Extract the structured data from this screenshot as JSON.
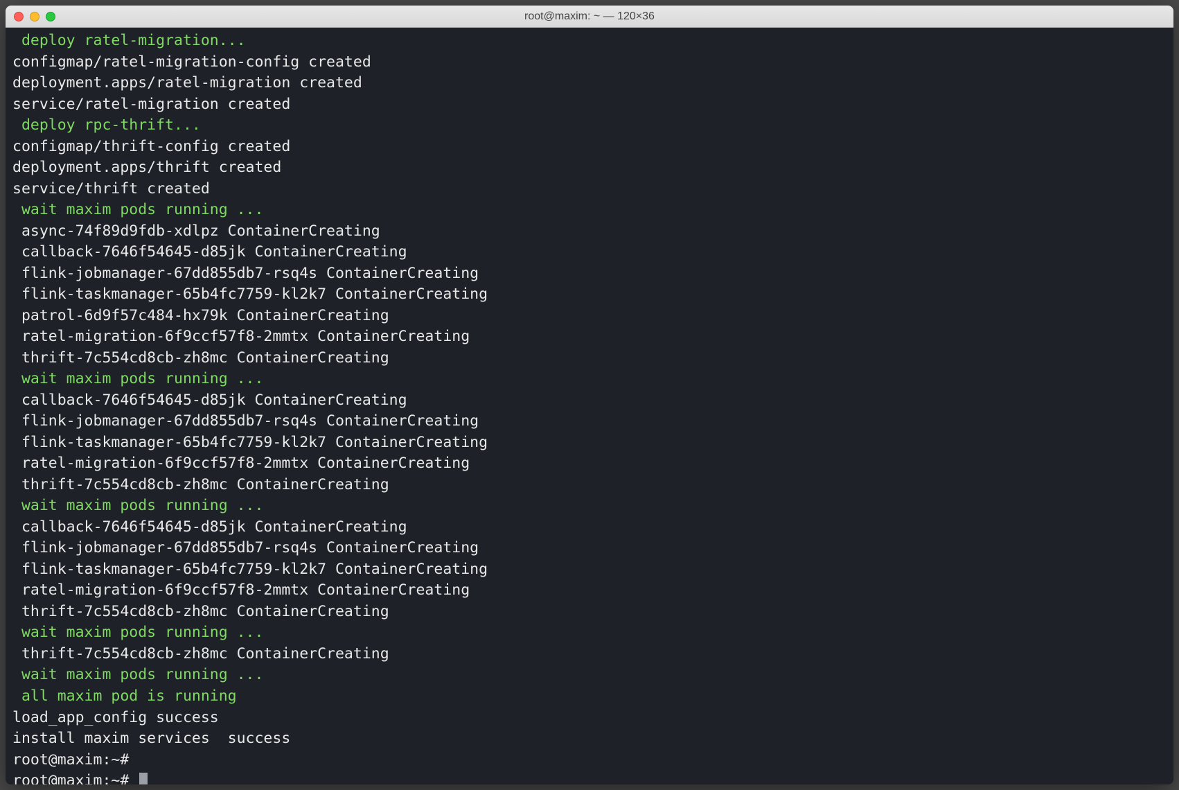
{
  "window": {
    "title": "root@maxim: ~ — 120×36"
  },
  "lines": [
    {
      "indent": " ",
      "text": "deploy ratel-migration...",
      "color": "green"
    },
    {
      "indent": "",
      "text": "configmap/ratel-migration-config created",
      "color": "white"
    },
    {
      "indent": "",
      "text": "deployment.apps/ratel-migration created",
      "color": "white"
    },
    {
      "indent": "",
      "text": "service/ratel-migration created",
      "color": "white"
    },
    {
      "indent": " ",
      "text": "deploy rpc-thrift...",
      "color": "green"
    },
    {
      "indent": "",
      "text": "configmap/thrift-config created",
      "color": "white"
    },
    {
      "indent": "",
      "text": "deployment.apps/thrift created",
      "color": "white"
    },
    {
      "indent": "",
      "text": "service/thrift created",
      "color": "white"
    },
    {
      "indent": " ",
      "text": "wait maxim pods running ...",
      "color": "green"
    },
    {
      "indent": " ",
      "text": "async-74f89d9fdb-xdlpz ContainerCreating",
      "color": "white"
    },
    {
      "indent": " ",
      "text": "callback-7646f54645-d85jk ContainerCreating",
      "color": "white"
    },
    {
      "indent": " ",
      "text": "flink-jobmanager-67dd855db7-rsq4s ContainerCreating",
      "color": "white"
    },
    {
      "indent": " ",
      "text": "flink-taskmanager-65b4fc7759-kl2k7 ContainerCreating",
      "color": "white"
    },
    {
      "indent": " ",
      "text": "patrol-6d9f57c484-hx79k ContainerCreating",
      "color": "white"
    },
    {
      "indent": " ",
      "text": "ratel-migration-6f9ccf57f8-2mmtx ContainerCreating",
      "color": "white"
    },
    {
      "indent": " ",
      "text": "thrift-7c554cd8cb-zh8mc ContainerCreating",
      "color": "white"
    },
    {
      "indent": " ",
      "text": "wait maxim pods running ...",
      "color": "green"
    },
    {
      "indent": " ",
      "text": "callback-7646f54645-d85jk ContainerCreating",
      "color": "white"
    },
    {
      "indent": " ",
      "text": "flink-jobmanager-67dd855db7-rsq4s ContainerCreating",
      "color": "white"
    },
    {
      "indent": " ",
      "text": "flink-taskmanager-65b4fc7759-kl2k7 ContainerCreating",
      "color": "white"
    },
    {
      "indent": " ",
      "text": "ratel-migration-6f9ccf57f8-2mmtx ContainerCreating",
      "color": "white"
    },
    {
      "indent": " ",
      "text": "thrift-7c554cd8cb-zh8mc ContainerCreating",
      "color": "white"
    },
    {
      "indent": " ",
      "text": "wait maxim pods running ...",
      "color": "green"
    },
    {
      "indent": " ",
      "text": "callback-7646f54645-d85jk ContainerCreating",
      "color": "white"
    },
    {
      "indent": " ",
      "text": "flink-jobmanager-67dd855db7-rsq4s ContainerCreating",
      "color": "white"
    },
    {
      "indent": " ",
      "text": "flink-taskmanager-65b4fc7759-kl2k7 ContainerCreating",
      "color": "white"
    },
    {
      "indent": " ",
      "text": "ratel-migration-6f9ccf57f8-2mmtx ContainerCreating",
      "color": "white"
    },
    {
      "indent": " ",
      "text": "thrift-7c554cd8cb-zh8mc ContainerCreating",
      "color": "white"
    },
    {
      "indent": " ",
      "text": "wait maxim pods running ...",
      "color": "green"
    },
    {
      "indent": " ",
      "text": "thrift-7c554cd8cb-zh8mc ContainerCreating",
      "color": "white"
    },
    {
      "indent": " ",
      "text": "wait maxim pods running ...",
      "color": "green"
    },
    {
      "indent": " ",
      "text": "all maxim pod is running",
      "color": "green"
    },
    {
      "indent": "",
      "text": "load_app_config success",
      "color": "white"
    },
    {
      "indent": "",
      "text": "install maxim services  success",
      "color": "white"
    }
  ],
  "prompts": [
    {
      "text": "root@maxim:~#",
      "cursor": false
    },
    {
      "text": "root@maxim:~#",
      "cursor": true
    }
  ]
}
